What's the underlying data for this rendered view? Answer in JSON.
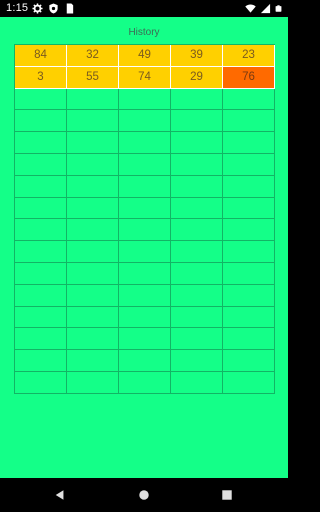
{
  "status_bar": {
    "time": "1:15",
    "left_icons": [
      "gear-icon",
      "shield-icon",
      "sim-card-icon"
    ],
    "right_icons": [
      "wifi-icon",
      "signal-icon",
      "battery-icon"
    ]
  },
  "app": {
    "title": "History",
    "background": "#14ff88",
    "cell_fill_color": "#ffd000",
    "cell_highlight_color": "#ff6a00",
    "columns": 5,
    "total_rows": 16,
    "rows": [
      [
        "84",
        "32",
        "49",
        "39",
        "23"
      ],
      [
        "3",
        "55",
        "74",
        "29",
        "76"
      ]
    ],
    "highlighted": [
      [
        1,
        4
      ]
    ]
  },
  "nav_bar": {
    "buttons": [
      "back-icon",
      "home-icon",
      "recents-icon"
    ]
  }
}
